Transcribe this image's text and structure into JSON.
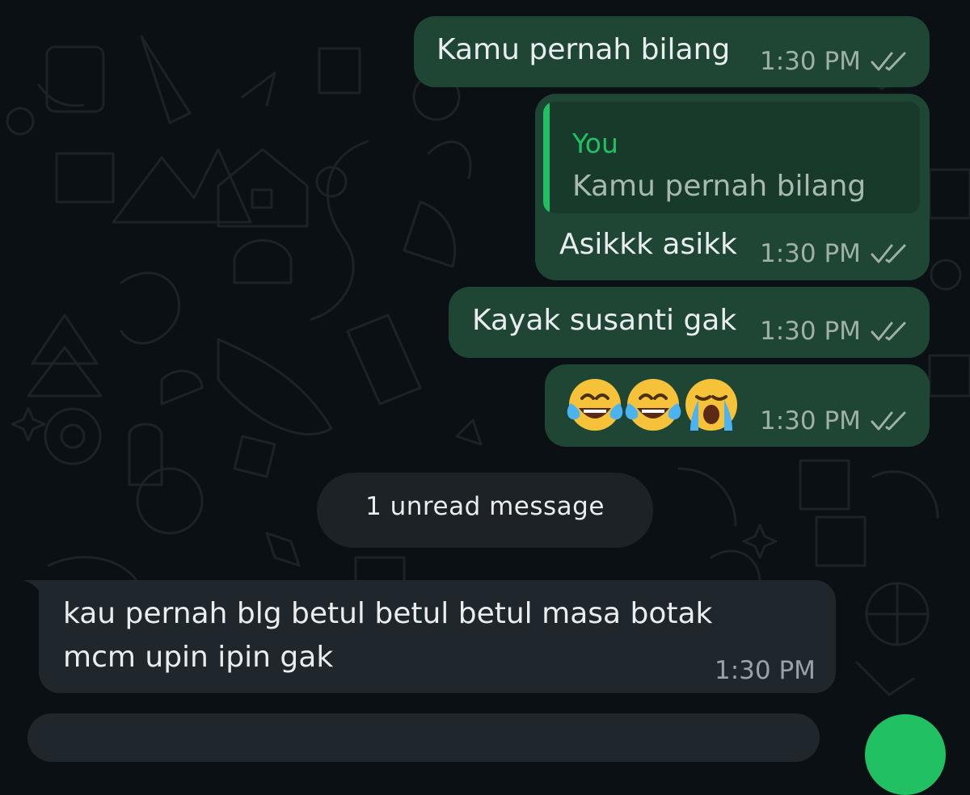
{
  "chat": {
    "messages": [
      {
        "direction": "outgoing",
        "text": "Kamu pernah bilang",
        "time": "1:30 PM",
        "status": "read"
      },
      {
        "direction": "outgoing",
        "reply_to": {
          "author": "You",
          "text": "Kamu pernah bilang"
        },
        "text": "Asikkk asikk",
        "time": "1:30 PM",
        "status": "read"
      },
      {
        "direction": "outgoing",
        "text": "Kayak susanti gak",
        "time": "1:30 PM",
        "status": "read"
      },
      {
        "direction": "outgoing",
        "emojis": [
          "face-with-tears-of-joy",
          "face-with-tears-of-joy",
          "loudly-crying-face"
        ],
        "time": "1:30 PM",
        "status": "read"
      },
      {
        "direction": "incoming",
        "text_lines": [
          "kau pernah blg betul betul betul masa botak",
          "mcm upin ipin gak"
        ],
        "time": "1:30 PM"
      }
    ],
    "unread_divider": "1 unread message"
  },
  "colors": {
    "background": "#0b1014",
    "outgoing_bubble": "#1f4634",
    "incoming_bubble": "#1f272c",
    "accent_green": "#21c063",
    "read_tick": "#9fb1a7"
  },
  "icons": [
    "double-check-icon",
    "send-fab-icon"
  ]
}
